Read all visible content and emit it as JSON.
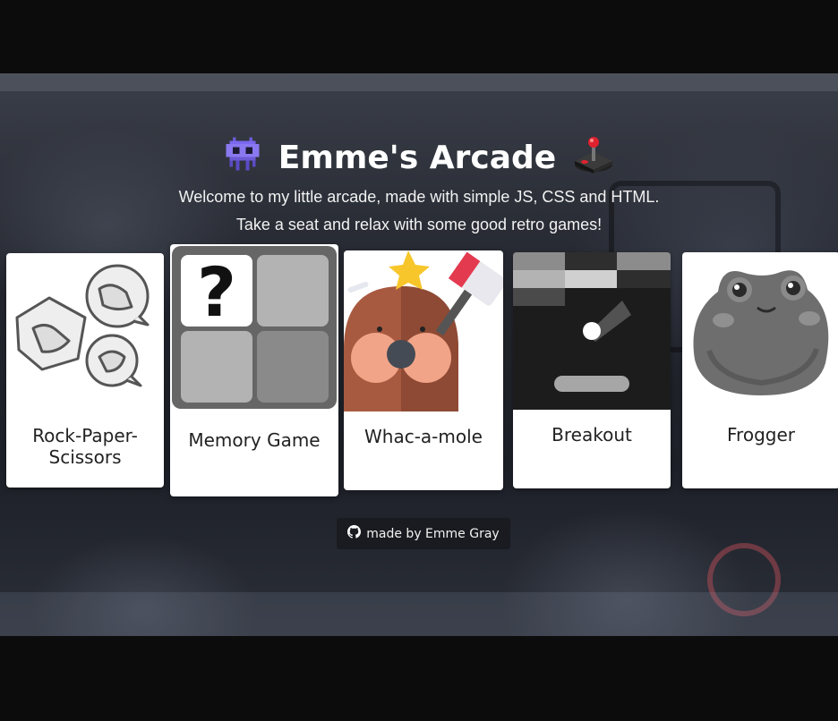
{
  "header": {
    "title": "Emme's Arcade",
    "subtitle_line1": "Welcome to my little arcade, made with simple JS, CSS and HTML.",
    "subtitle_line2": "Take a seat and relax with some good retro games!",
    "left_icon": "alien-monster-icon",
    "right_icon": "joystick-icon"
  },
  "games": [
    {
      "label": "Rock-Paper-\nScissors",
      "icon": "rock-paper-scissors-icon"
    },
    {
      "label": "Memory Game",
      "icon": "memory-cards-icon"
    },
    {
      "label": "Whac-a-mole",
      "icon": "mole-icon"
    },
    {
      "label": "Breakout",
      "icon": "breakout-icon"
    },
    {
      "label": "Frogger",
      "icon": "frog-icon"
    }
  ],
  "footer": {
    "text": "made by Emme Gray",
    "icon": "github-icon"
  },
  "colors": {
    "page_bg": "#0c0c0c",
    "card_bg": "#ffffff",
    "title_text": "#ffffff",
    "badge_bg": "#1a1b20"
  }
}
